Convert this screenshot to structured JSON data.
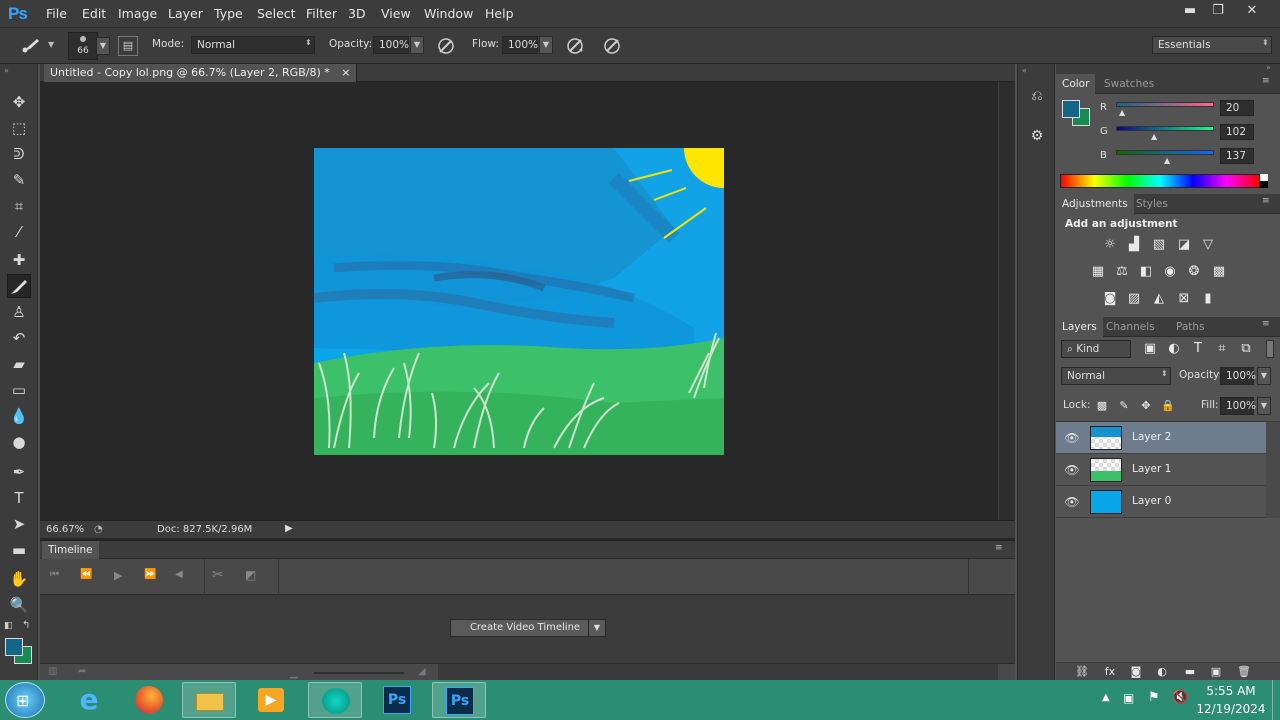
{
  "app": {
    "logo": "Ps"
  },
  "menu": [
    "File",
    "Edit",
    "Image",
    "Layer",
    "Type",
    "Select",
    "Filter",
    "3D",
    "View",
    "Window",
    "Help"
  ],
  "window_controls": {
    "minimize": "▬",
    "restore": "❐",
    "close": "✕"
  },
  "options": {
    "brush_size": "66",
    "mode_label": "Mode:",
    "mode_value": "Normal",
    "opacity_label": "Opacity:",
    "opacity_value": "100%",
    "flow_label": "Flow:",
    "flow_value": "100%",
    "workspace": "Essentials"
  },
  "tools": [
    "move-tool-icon",
    "marquee-tool-icon",
    "lasso-tool-icon",
    "quick-selection-tool-icon",
    "crop-tool-icon",
    "eyedropper-tool-icon",
    "healing-brush-tool-icon",
    "brush-tool-icon",
    "clone-stamp-tool-icon",
    "history-brush-tool-icon",
    "eraser-tool-icon",
    "gradient-tool-icon",
    "blur-tool-icon",
    "dodge-tool-icon",
    "pen-tool-icon",
    "type-tool-icon",
    "path-selection-tool-icon",
    "rectangle-tool-icon",
    "hand-tool-icon",
    "zoom-tool-icon"
  ],
  "document": {
    "tab_title": "Untitled - Copy lol.png @ 66.7% (Layer 2, RGB/8) *",
    "tab_close": "×"
  },
  "status": {
    "zoom": "66.67%",
    "doc": "Doc: 827.5K/2.96M"
  },
  "timeline": {
    "title": "Timeline",
    "create_button": "Create Video Timeline"
  },
  "color_panel": {
    "tabs": [
      "Color",
      "Swatches"
    ],
    "r_label": "R",
    "r_value": "20",
    "g_label": "G",
    "g_value": "102",
    "b_label": "B",
    "b_value": "137",
    "foreground": "#146689",
    "background": "#1a8a52"
  },
  "adjustments_panel": {
    "tabs": [
      "Adjustments",
      "Styles"
    ],
    "heading": "Add an adjustment"
  },
  "layers_panel": {
    "tabs": [
      "Layers",
      "Channels",
      "Paths"
    ],
    "kind": "Kind",
    "blend_mode": "Normal",
    "opacity_label": "Opacity:",
    "opacity_value": "100%",
    "lock_label": "Lock:",
    "fill_label": "Fill:",
    "fill_value": "100%",
    "layers": [
      {
        "name": "Layer 2",
        "selected": true
      },
      {
        "name": "Layer 1",
        "selected": false
      },
      {
        "name": "Layer 0",
        "selected": false
      }
    ]
  },
  "taskbar": {
    "time": "5:55 AM",
    "date": "12/19/2024",
    "apps": [
      "start-button",
      "internet-explorer-icon",
      "firefox-icon",
      "file-explorer-icon",
      "media-player-icon",
      "browser-app-icon",
      "photoshop-icon",
      "photoshop-active-icon"
    ],
    "ps_label": "Ps"
  }
}
